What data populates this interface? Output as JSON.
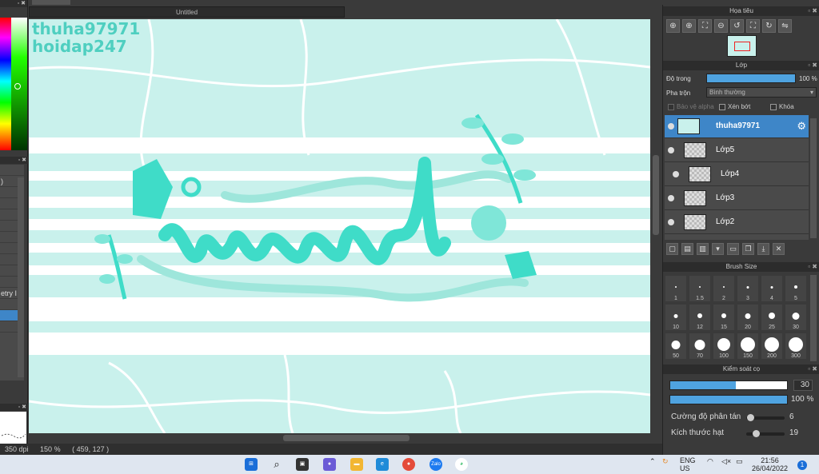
{
  "window": {
    "title": "Untitled"
  },
  "canvas": {
    "watermark_lines": [
      "thuha97971",
      "hoidap247"
    ]
  },
  "left_panel": {
    "rows": [
      "",
      ")",
      "",
      "",
      "",
      "",
      "",
      "",
      "",
      "",
      "",
      "etry I",
      "",
      "",
      ""
    ],
    "selected_index": 13
  },
  "status": {
    "dpi": "350 dpi",
    "zoom": "150 %",
    "coords": "( 459, 127 )"
  },
  "navigator": {
    "title": "Họa tiêu"
  },
  "layer_panel": {
    "title": "Lớp",
    "opacity_label": "Độ trong",
    "opacity_value": "100 %",
    "opacity_fraction": 1.0,
    "blend_label": "Pha trộn",
    "blend_value": "Bình thường",
    "protect_alpha": "Bảo vệ alpha",
    "clip": "Xén bớt",
    "lock": "Khóa",
    "layers": [
      {
        "name": "thuha97971",
        "selected": true
      },
      {
        "name": "Lớp5",
        "selected": false
      },
      {
        "name": "Lớp4",
        "selected": false
      },
      {
        "name": "Lớp3",
        "selected": false
      },
      {
        "name": "Lớp2",
        "selected": false
      }
    ]
  },
  "brush_size": {
    "title": "Brush Size",
    "sizes": [
      "1",
      "1.5",
      "2",
      "3",
      "4",
      "5",
      "10",
      "12",
      "15",
      "20",
      "25",
      "30",
      "50",
      "70",
      "100",
      "150",
      "200",
      "300"
    ]
  },
  "brush_control": {
    "title": "Kiểm soát cọ",
    "size_value": "30",
    "size_fraction": 0.56,
    "opacity_value": "100 %",
    "scatter_label": "Cường độ phân tán",
    "scatter_value": "6",
    "particle_label": "Kích thước hạt",
    "particle_value": "19"
  },
  "taskbar": {
    "zalo_label": "Zalo",
    "lang": "ENG",
    "region": "US",
    "time": "21:56",
    "date": "26/04/2022",
    "notification_count": "1"
  },
  "colors": {
    "accent": "#3e86c8",
    "canvas_bg": "#c9f1ec",
    "teal": "#3fdcc8"
  }
}
